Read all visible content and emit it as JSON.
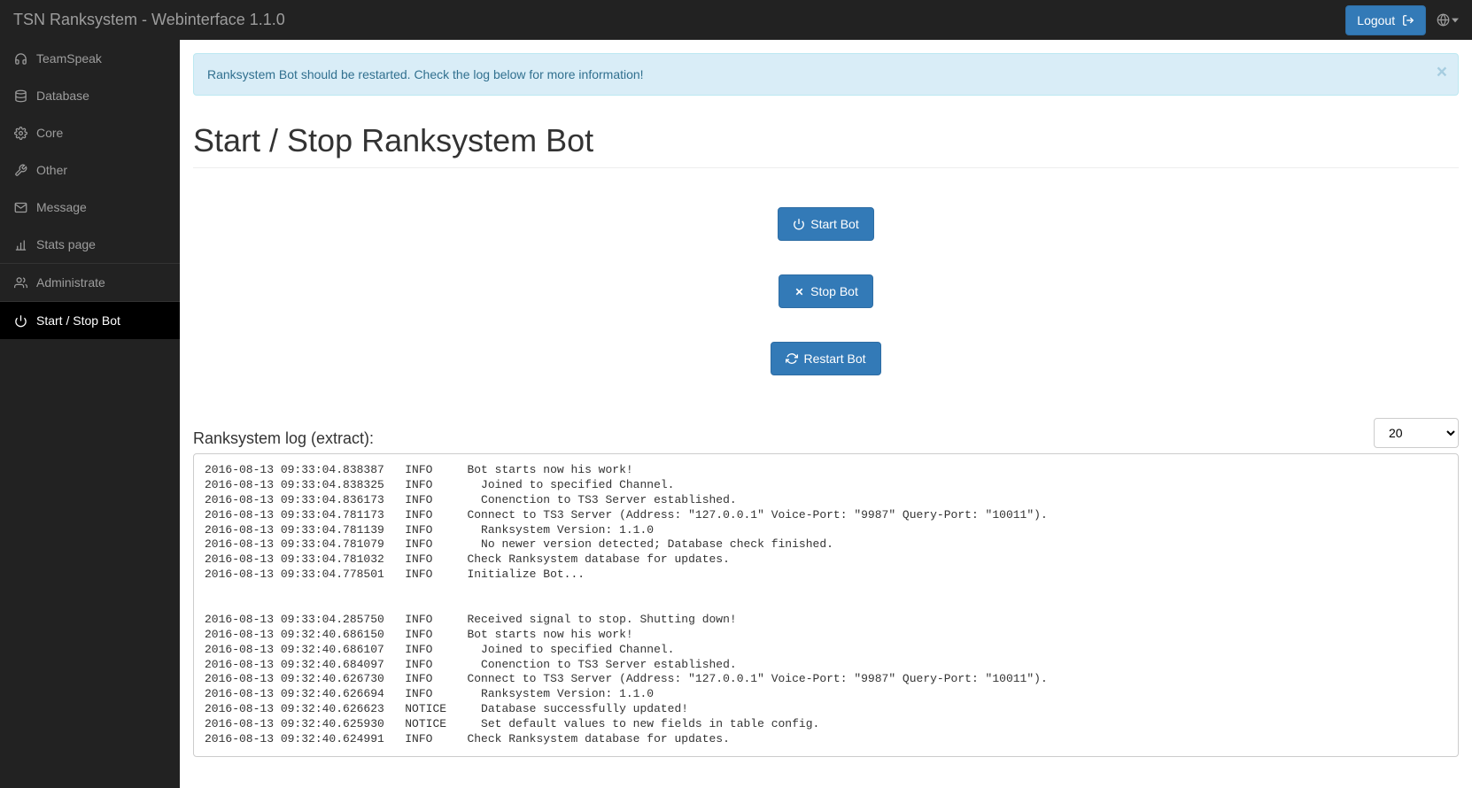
{
  "navbar": {
    "brand": "TSN Ranksystem - Webinterface 1.1.0",
    "logout_label": "Logout"
  },
  "sidebar": {
    "items": [
      {
        "label": "TeamSpeak",
        "icon": "headphones"
      },
      {
        "label": "Database",
        "icon": "database"
      },
      {
        "label": "Core",
        "icon": "cogs"
      },
      {
        "label": "Other",
        "icon": "wrench"
      },
      {
        "label": "Message",
        "icon": "envelope"
      },
      {
        "label": "Stats page",
        "icon": "barchart"
      }
    ],
    "items_sep1": [
      {
        "label": "Administrate",
        "icon": "users"
      }
    ],
    "items_sep2": [
      {
        "label": "Start / Stop Bot",
        "icon": "power",
        "active": true
      }
    ]
  },
  "alert": {
    "text": "Ranksystem Bot should be restarted. Check the log below for more information!"
  },
  "page_title": "Start / Stop Ranksystem Bot",
  "buttons": {
    "start": "Start Bot",
    "stop": "Stop Bot",
    "restart": "Restart Bot"
  },
  "log_section": {
    "title": "Ranksystem log (extract):",
    "select_value": "20"
  },
  "log_lines": [
    "2016-08-13 09:33:04.838387   INFO     Bot starts now his work!",
    "2016-08-13 09:33:04.838325   INFO       Joined to specified Channel.",
    "2016-08-13 09:33:04.836173   INFO       Conenction to TS3 Server established.",
    "2016-08-13 09:33:04.781173   INFO     Connect to TS3 Server (Address: \"127.0.0.1\" Voice-Port: \"9987\" Query-Port: \"10011\").",
    "2016-08-13 09:33:04.781139   INFO       Ranksystem Version: 1.1.0",
    "2016-08-13 09:33:04.781079   INFO       No newer version detected; Database check finished.",
    "2016-08-13 09:33:04.781032   INFO     Check Ranksystem database for updates.",
    "2016-08-13 09:33:04.778501   INFO     Initialize Bot...",
    "",
    "",
    "2016-08-13 09:33:04.285750   INFO     Received signal to stop. Shutting down!",
    "2016-08-13 09:32:40.686150   INFO     Bot starts now his work!",
    "2016-08-13 09:32:40.686107   INFO       Joined to specified Channel.",
    "2016-08-13 09:32:40.684097   INFO       Conenction to TS3 Server established.",
    "2016-08-13 09:32:40.626730   INFO     Connect to TS3 Server (Address: \"127.0.0.1\" Voice-Port: \"9987\" Query-Port: \"10011\").",
    "2016-08-13 09:32:40.626694   INFO       Ranksystem Version: 1.1.0",
    "2016-08-13 09:32:40.626623   NOTICE     Database successfully updated!",
    "2016-08-13 09:32:40.625930   NOTICE     Set default values to new fields in table config.",
    "2016-08-13 09:32:40.624991   INFO     Check Ranksystem database for updates."
  ]
}
